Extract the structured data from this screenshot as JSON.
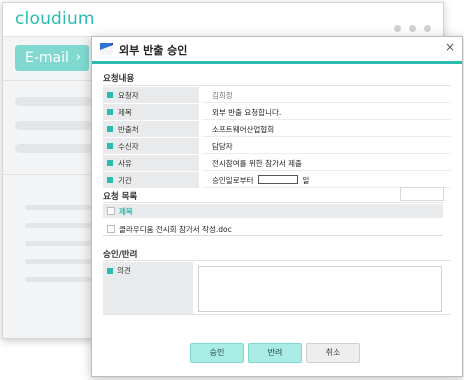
{
  "app": {
    "brand": "cloudium"
  },
  "sidebar": {
    "email_button": "E-mail",
    "chevron": "›"
  },
  "dialog": {
    "title": "외부 반출 승인",
    "close": "×",
    "request_section": "요청내용",
    "fields": [
      {
        "label": "요청자",
        "value": "김희정"
      },
      {
        "label": "제목",
        "value": "외부 반출 요청합니다."
      },
      {
        "label": "반출처",
        "value": "소프트웨어산업협회"
      },
      {
        "label": "수신자",
        "value": "담당자"
      },
      {
        "label": "사유",
        "value": "전시참여를 위한 참가서 제출"
      },
      {
        "label": "기간",
        "value": "승인일로부터",
        "suffix": "일"
      }
    ],
    "list_section": "요청 목록",
    "list_header": "제목",
    "list_items": [
      "클라우디움 전시회 참가서 작성.doc"
    ],
    "approve_section": "승인/반려",
    "opinion_label": "의견",
    "buttons": {
      "approve": "승인",
      "reject": "반려",
      "cancel": "취소"
    }
  },
  "colors": {
    "accent": "#2bbcb0",
    "accent_light": "#a9ebe5",
    "label_bg": "#e9eaeb",
    "logo": "#1f3a8a"
  }
}
